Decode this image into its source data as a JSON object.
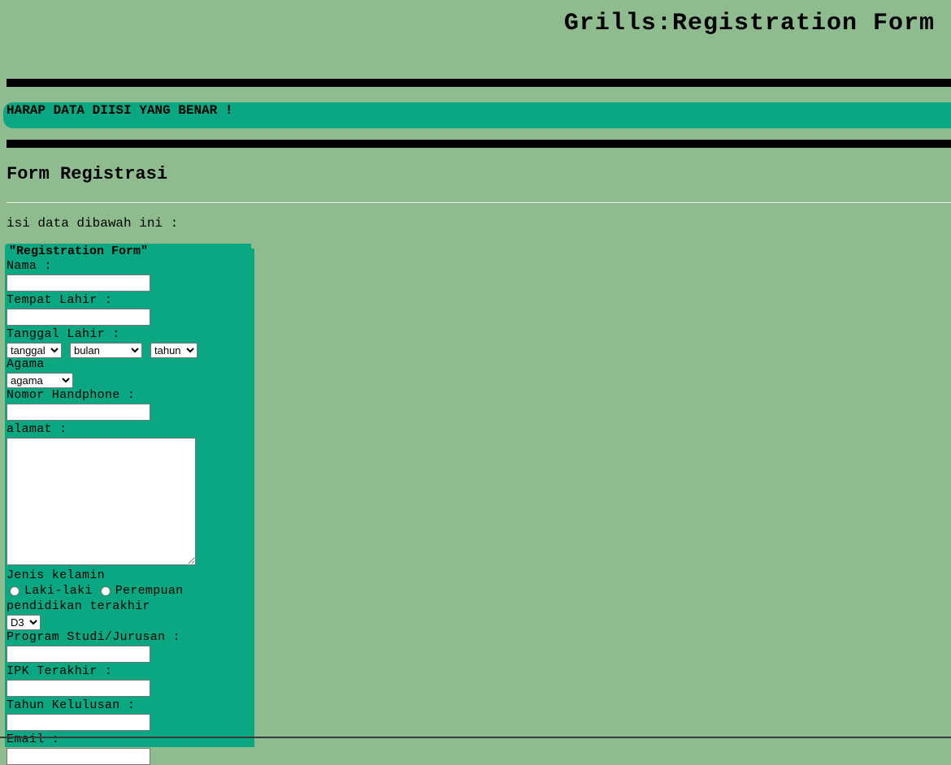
{
  "header": {
    "title": "Grills:Registration Form"
  },
  "notice": {
    "text": "HARAP DATA DIISI YANG BENAR !"
  },
  "section": {
    "title": "Form Registrasi",
    "intro": "isi data dibawah ini :"
  },
  "form": {
    "legend": "\"Registration Form\"",
    "nama_label": "Nama :",
    "nama_value": "",
    "tempat_lahir_label": "Tempat Lahir :",
    "tempat_lahir_value": "",
    "tanggal_lahir_label": "Tanggal Lahir :",
    "tanggal_selected": "tanggal",
    "bulan_selected": "bulan",
    "tahun_selected": "tahun",
    "agama_label": "Agama",
    "agama_selected": "agama",
    "hp_label": "Nomor Handphone :",
    "hp_value": "",
    "alamat_label": "alamat :",
    "alamat_value": "",
    "gender_label": "Jenis kelamin",
    "gender_options": [
      "Laki-laki",
      "Perempuan"
    ],
    "pendidikan_label": "pendidikan terakhir",
    "pendidikan_selected": "D3",
    "prodi_label": "Program Studi/Jurusan :",
    "prodi_value": "",
    "ipk_label": "IPK Terakhir :",
    "ipk_value": "",
    "tahun_lulus_label": "Tahun Kelulusan :",
    "tahun_lulus_value": "",
    "email_label": "Email :",
    "email_value": ""
  },
  "colors": {
    "background": "#8fbc8f",
    "panel": "#0aa882",
    "bars": "#000000"
  }
}
